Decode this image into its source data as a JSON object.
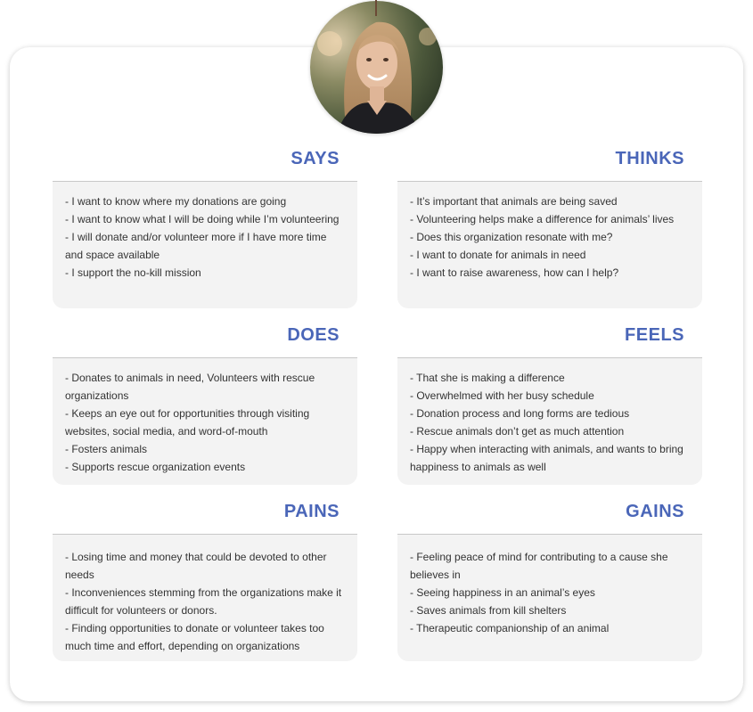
{
  "sections": {
    "says": {
      "title": "SAYS",
      "items": [
        "- I want to know where my donations are going",
        "- I want to know what I will be doing while I’m volunteering",
        "- I will donate and/or volunteer more if I have more time and space available",
        "- I support the no-kill mission"
      ]
    },
    "thinks": {
      "title": "THINKS",
      "items": [
        "- It’s important that animals are being saved",
        "- Volunteering helps make a difference for animals’ lives",
        "- Does this organization resonate with me?",
        "- I want to donate for animals in need",
        "- I want to raise awareness, how can I help?"
      ]
    },
    "does": {
      "title": "DOES",
      "items": [
        "- Donates to animals in need, Volunteers with rescue organizations",
        "- Keeps an eye out for opportunities through visiting websites, social media, and word-of-mouth",
        "- Fosters animals",
        "- Supports rescue organization events"
      ]
    },
    "feels": {
      "title": "FEELS",
      "items": [
        "- That she is making a difference",
        "- Overwhelmed with her busy schedule",
        "- Donation process and long forms are tedious",
        "- Rescue animals don’t get as much attention",
        "- Happy when interacting with animals, and wants to bring happiness to animals as well"
      ]
    },
    "pains": {
      "title": "PAINS",
      "items": [
        "- Losing time and money that could be devoted to other needs",
        "- Inconveniences stemming from the organizations make it difficult for volunteers or donors.",
        "- Finding opportunities to donate or volunteer takes too much time and effort, depending on organizations"
      ]
    },
    "gains": {
      "title": "GAINS",
      "items": [
        "- Feeling peace of mind for contributing to a cause she believes in",
        "- Seeing happiness in an animal’s eyes",
        "- Saves animals from kill shelters",
        "- Therapeutic companionship of an animal"
      ]
    }
  },
  "colors": {
    "heading": "#4a66b8",
    "box_background": "#f3f3f3",
    "text": "#333333"
  }
}
